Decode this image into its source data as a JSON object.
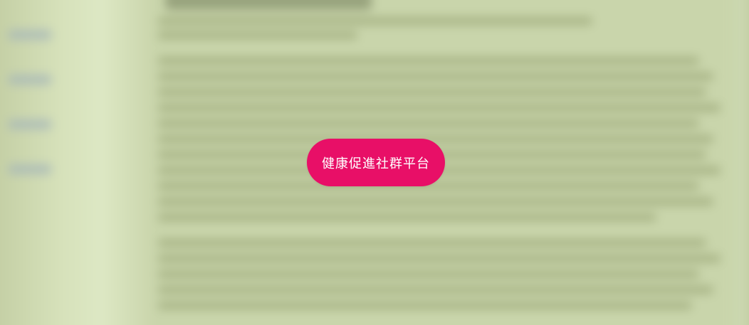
{
  "overlay": {
    "button_label": "健康促進社群平台",
    "button_color": "#e80f67",
    "text_color": "#ffffff"
  },
  "background": {
    "blurred": true,
    "base_color": "#ccd8b1",
    "sidebar_color": "#dde8c4"
  }
}
